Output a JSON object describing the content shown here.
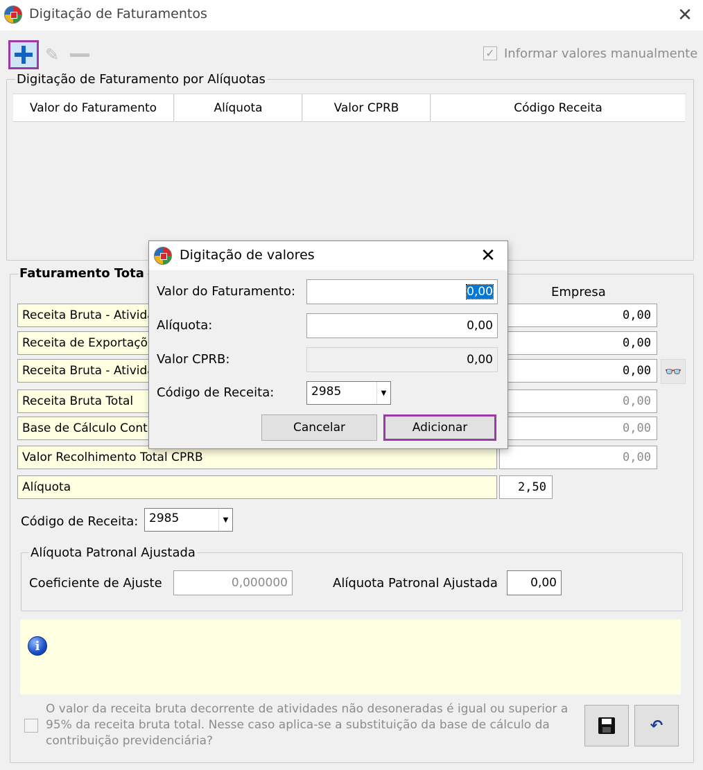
{
  "window": {
    "title": "Digitação de Faturamentos",
    "close": "✕"
  },
  "toolbar": {
    "add_icon": "plus-icon",
    "edit_icon": "pencil-icon",
    "remove_icon": "minus-icon"
  },
  "manual": {
    "label": "Informar valores manualmente",
    "checked": true
  },
  "aliquotas_group": {
    "title": "Digitação de Faturamento por Alíquotas",
    "columns": [
      "Valor do Faturamento",
      "Alíquota",
      "Valor CPRB",
      "Código Receita"
    ],
    "rows": []
  },
  "total_group": {
    "title": "Faturamento Tota",
    "empresa_header": "Empresa",
    "rows": [
      {
        "label": "Receita Bruta - Ativida",
        "value": "0,00"
      },
      {
        "label": "Receita de Exportaçõ",
        "value": "0,00"
      },
      {
        "label": "Receita Bruta - Ativida",
        "value": "0,00"
      },
      {
        "label": "Receita Bruta Total",
        "value": "0,00"
      },
      {
        "label": "Base de Cálculo Cont",
        "value": "0,00"
      },
      {
        "label": "Valor Recolhimento Total CPRB",
        "value": "0,00"
      },
      {
        "label": "Alíquota",
        "value": "2,50"
      }
    ],
    "codigo_label": "Código de Receita:",
    "codigo_value": "2985"
  },
  "patronal": {
    "title": "Alíquota Patronal Ajustada",
    "coef_label": "Coeficiente de Ajuste",
    "coef_value": "0,000000",
    "aliq_label": "Alíquota Patronal Ajustada",
    "aliq_value": "0,00"
  },
  "info": {
    "icon": "info-icon"
  },
  "footer": {
    "text": "O valor da receita bruta decorrente de atividades não desoneradas é igual ou superior a 95% da receita bruta total. Nesse caso aplica-se a substituição da base de cálculo da contribuição previdenciária?",
    "checked": false
  },
  "actions": {
    "save_icon": "floppy-disk-icon",
    "undo_icon": "undo-icon"
  },
  "dialog": {
    "title": "Digitação de valores",
    "close": "✕",
    "fields": {
      "valor_faturamento": {
        "label": "Valor do Faturamento:",
        "value": "0,00"
      },
      "aliquota": {
        "label": "Alíquota:",
        "value": "0,00"
      },
      "valor_cprb": {
        "label": "Valor CPRB:",
        "value": "0,00"
      },
      "codigo": {
        "label": "Código de Receita:",
        "value": "2985"
      }
    },
    "cancel_label": "Cancelar",
    "add_label": "Adicionar"
  }
}
